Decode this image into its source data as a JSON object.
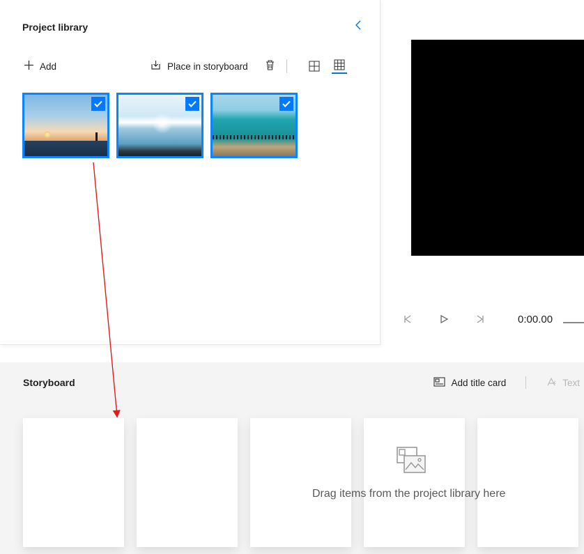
{
  "library": {
    "title": "Project library",
    "add_label": "Add",
    "place_label": "Place in storyboard",
    "thumbs": [
      {
        "selected": true
      },
      {
        "selected": true
      },
      {
        "selected": true
      }
    ]
  },
  "preview": {
    "timecode": "0:00.00"
  },
  "storyboard": {
    "title": "Storyboard",
    "add_title_card_label": "Add title card",
    "text_label": "Text",
    "hint": "Drag items from the project library here"
  }
}
